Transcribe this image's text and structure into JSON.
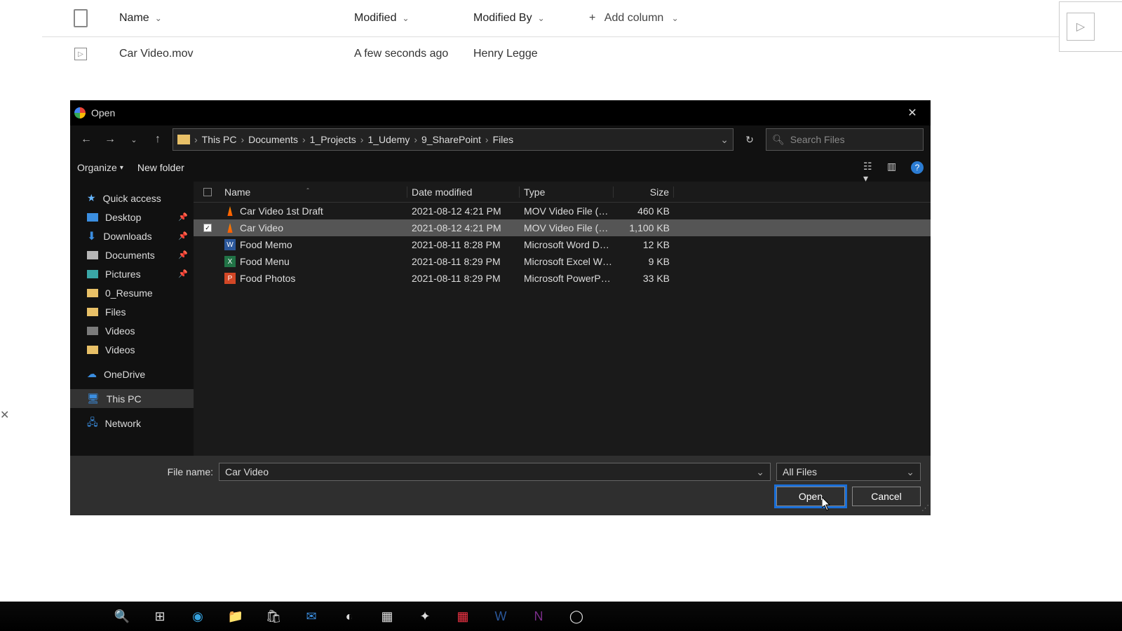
{
  "sharepoint": {
    "columns": {
      "name": "Name",
      "modified": "Modified",
      "modifiedBy": "Modified By",
      "add": "Add column"
    },
    "row": {
      "name": "Car Video.mov",
      "modified": "A few seconds ago",
      "modifiedBy": "Henry Legge"
    }
  },
  "dialog": {
    "title": "Open",
    "breadcrumbs": [
      "This PC",
      "Documents",
      "1_Projects",
      "1_Udemy",
      "9_SharePoint",
      "Files"
    ],
    "searchPlaceholder": "Search Files",
    "organize": "Organize",
    "newFolder": "New folder",
    "sidebar": {
      "quickAccess": "Quick access",
      "desktop": "Desktop",
      "downloads": "Downloads",
      "documents": "Documents",
      "pictures": "Pictures",
      "resume": "0_Resume",
      "files": "Files",
      "videos1": "Videos",
      "videos2": "Videos",
      "onedrive": "OneDrive",
      "thisPC": "This PC",
      "network": "Network"
    },
    "columns": {
      "name": "Name",
      "date": "Date modified",
      "type": "Type",
      "size": "Size"
    },
    "files": [
      {
        "name": "Car Video 1st Draft",
        "date": "2021-08-12 4:21 PM",
        "type": "MOV Video File (V…",
        "size": "460 KB",
        "icon": "vlc",
        "selected": false
      },
      {
        "name": "Car Video",
        "date": "2021-08-12 4:21 PM",
        "type": "MOV Video File (V…",
        "size": "1,100 KB",
        "icon": "vlc",
        "selected": true
      },
      {
        "name": "Food Memo",
        "date": "2021-08-11 8:28 PM",
        "type": "Microsoft Word D…",
        "size": "12 KB",
        "icon": "word",
        "selected": false
      },
      {
        "name": "Food Menu",
        "date": "2021-08-11 8:29 PM",
        "type": "Microsoft Excel W…",
        "size": "9 KB",
        "icon": "excel",
        "selected": false
      },
      {
        "name": "Food Photos",
        "date": "2021-08-11 8:29 PM",
        "type": "Microsoft PowerP…",
        "size": "33 KB",
        "icon": "ppt",
        "selected": false
      }
    ],
    "fileNameLabel": "File name:",
    "fileNameValue": "Car Video",
    "filter": "All Files",
    "open": "Open",
    "cancel": "Cancel"
  }
}
